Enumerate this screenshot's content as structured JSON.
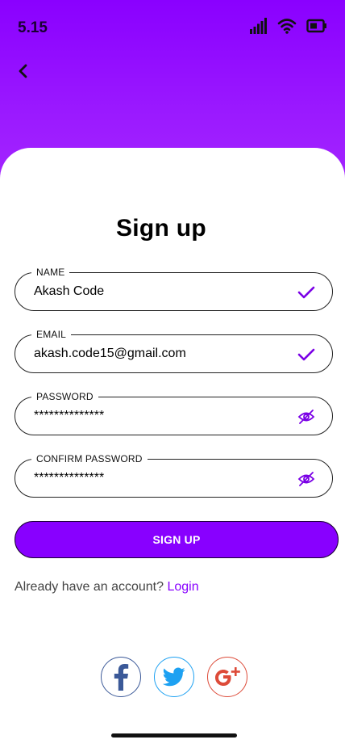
{
  "status_bar": {
    "time": "5.15"
  },
  "page": {
    "title": "Sign up"
  },
  "form": {
    "name": {
      "label": "NAME",
      "value": "Akash Code"
    },
    "email": {
      "label": "EMAIL",
      "value": "akash.code15@gmail.com"
    },
    "password": {
      "label": "PASSWORD",
      "value": "**************"
    },
    "confirm_password": {
      "label": "CONFIRM PASSWORD",
      "value": "**************"
    },
    "submit_label": "SIGN UP"
  },
  "login_prompt": {
    "text": "Already have an account? ",
    "link": "Login"
  },
  "social": {
    "facebook_icon": "facebook-icon",
    "twitter_icon": "twitter-icon",
    "google_plus_icon": "google-plus-icon"
  },
  "colors": {
    "accent": "#8800ff",
    "check": "#7a00e6",
    "facebook": "#3b5998",
    "twitter": "#1da1f2",
    "google": "#dd4b39"
  }
}
